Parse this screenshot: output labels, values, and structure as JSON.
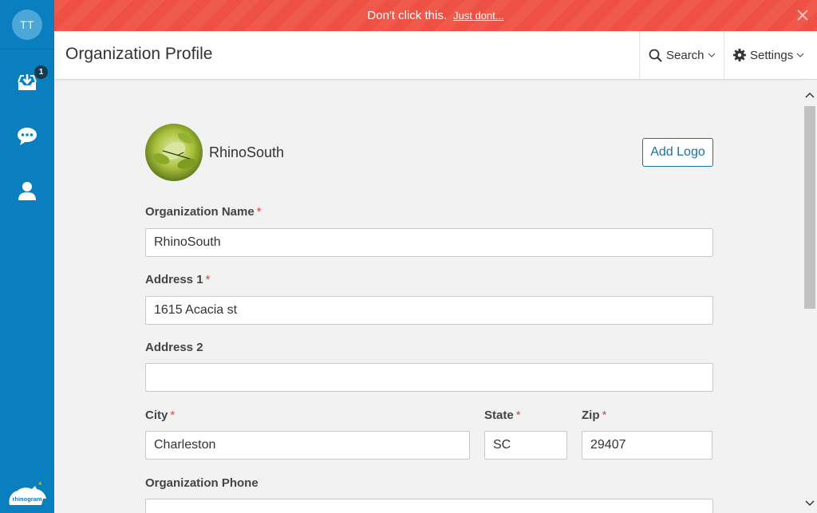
{
  "sidebar": {
    "avatar_initials": "TT",
    "inbox_badge": "1",
    "items": [
      {
        "name": "inbox",
        "icon": "inbox-download-icon"
      },
      {
        "name": "messages",
        "icon": "chat-bubble-icon"
      },
      {
        "name": "contacts",
        "icon": "person-icon"
      }
    ],
    "brand": "rhinogram"
  },
  "banner": {
    "message": "Don't click this.",
    "link_text": "Just dont...",
    "color": "#f05a4c"
  },
  "header": {
    "title": "Organization Profile",
    "search_label": "Search",
    "settings_label": "Settings"
  },
  "profile": {
    "org_display_name": "RhinoSouth",
    "add_logo_label": "Add Logo"
  },
  "form": {
    "org_name": {
      "label": "Organization Name",
      "required": "*",
      "value": "RhinoSouth"
    },
    "address1": {
      "label": "Address 1",
      "required": "*",
      "value": "1615 Acacia st"
    },
    "address2": {
      "label": "Address 2",
      "value": ""
    },
    "city": {
      "label": "City",
      "required": "*",
      "value": "Charleston"
    },
    "state": {
      "label": "State",
      "required": "*",
      "value": "SC"
    },
    "zip": {
      "label": "Zip",
      "required": "*",
      "value": "29407"
    },
    "phone": {
      "label": "Organization Phone",
      "value": ""
    }
  },
  "colors": {
    "sidebar": "#0a7fc0",
    "accent": "#1d6fa5",
    "required": "#e0463c"
  }
}
